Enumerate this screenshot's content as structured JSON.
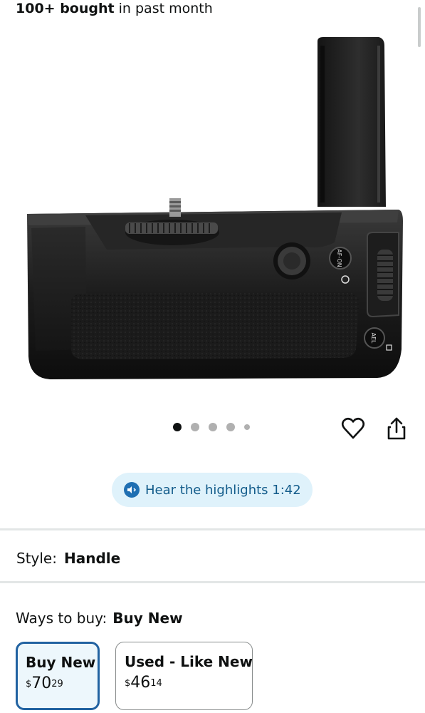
{
  "header": {
    "bought_bold": "100+ bought",
    "bought_rest": " in past month"
  },
  "gallery": {
    "image_icon": "camera-battery-grip-image",
    "dot_count": 5,
    "active_dot": 1,
    "heart_icon": "heart-icon",
    "share_icon": "share-icon"
  },
  "highlights": {
    "label": "Hear the highlights 1:42",
    "icon": "speaker-icon",
    "bg_color": "#dff2fb",
    "text_color": "#135c8b"
  },
  "style": {
    "label": "Style:",
    "value": "Handle"
  },
  "ways_to_buy": {
    "label": "Ways to buy:",
    "value": "Buy New",
    "options": [
      {
        "title": "Buy New",
        "currency": "$",
        "whole": "70",
        "fraction": "29",
        "selected": true
      },
      {
        "title": "Used - Like New",
        "currency": "$",
        "whole": "46",
        "fraction": "14",
        "selected": false
      }
    ],
    "selected_border_color": "#2162a1"
  }
}
